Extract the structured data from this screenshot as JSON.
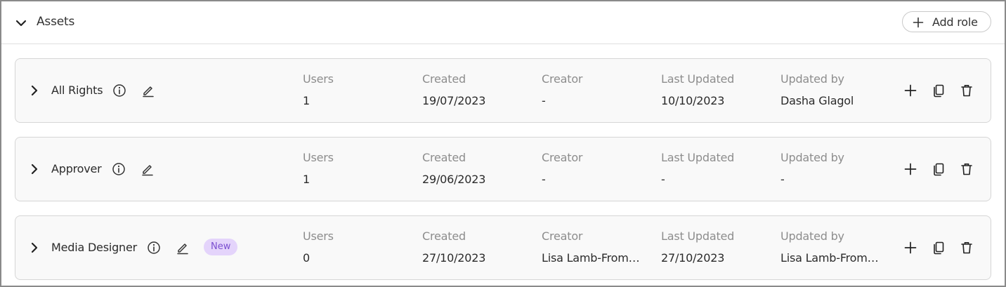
{
  "section": {
    "title": "Assets",
    "add_role_label": "Add role"
  },
  "columns": {
    "users": "Users",
    "created": "Created",
    "creator": "Creator",
    "last_updated": "Last Updated",
    "updated_by": "Updated by"
  },
  "roles": [
    {
      "name": "All Rights",
      "badge": "",
      "users": "1",
      "created": "19/07/2023",
      "creator": "-",
      "last_updated": "10/10/2023",
      "updated_by": "Dasha Glagol"
    },
    {
      "name": "Approver",
      "badge": "",
      "users": "1",
      "created": "29/06/2023",
      "creator": "-",
      "last_updated": "-",
      "updated_by": "-"
    },
    {
      "name": "Media Designer",
      "badge": "New",
      "users": "0",
      "created": "27/10/2023",
      "creator": "Lisa Lamb-Fromp...",
      "last_updated": "27/10/2023",
      "updated_by": "Lisa Lamb-Fromp..."
    }
  ],
  "colors": {
    "badge_bg": "#e4d4fb",
    "badge_text": "#7b4fd0",
    "card_bg": "#f9f9f9",
    "label_text": "#8d8d8d"
  },
  "icons": {
    "collapse": "chevron-down-icon",
    "expand": "chevron-right-icon",
    "info": "info-icon",
    "edit": "pencil-icon",
    "add": "plus-icon",
    "copy": "copy-icon",
    "delete": "trash-icon"
  }
}
